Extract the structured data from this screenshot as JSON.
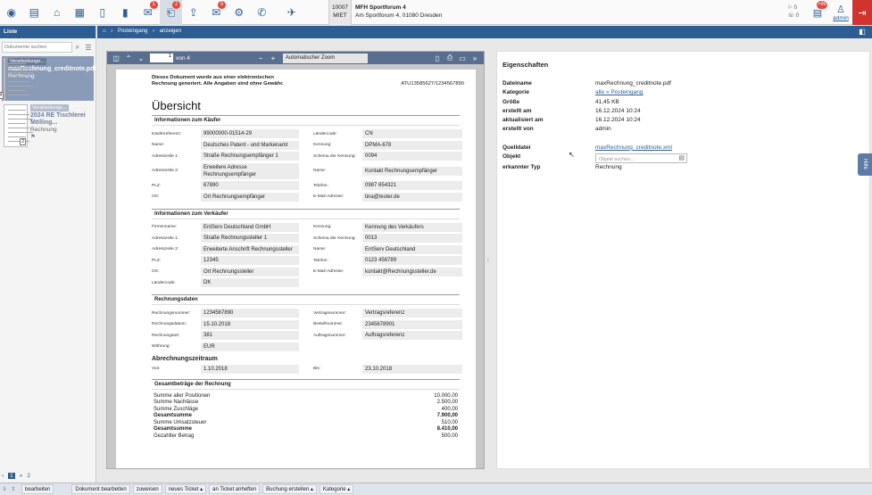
{
  "toolbar": {
    "icons": [
      {
        "name": "globe-icon",
        "glyph": "◉",
        "badge": ""
      },
      {
        "name": "card-icon",
        "glyph": "▤",
        "badge": ""
      },
      {
        "name": "home-icon",
        "glyph": "⌂",
        "badge": ""
      },
      {
        "name": "calendar-icon",
        "glyph": "▦",
        "badge": ""
      },
      {
        "name": "document-icon",
        "glyph": "▯",
        "badge": ""
      },
      {
        "name": "chart-icon",
        "glyph": "▮",
        "badge": ""
      },
      {
        "name": "mail-icon",
        "glyph": "✉",
        "badge": "1"
      },
      {
        "name": "inbox-icon",
        "glyph": "⎗",
        "badge": "2"
      },
      {
        "name": "upload-icon",
        "glyph": "⇪",
        "badge": ""
      },
      {
        "name": "mail-outgoing-icon",
        "glyph": "✉",
        "badge": "5"
      },
      {
        "name": "gear-icon",
        "glyph": "⚙",
        "badge": ""
      },
      {
        "name": "phone-icon",
        "glyph": "✆",
        "badge": ""
      },
      {
        "name": "rocket-icon",
        "glyph": "✈",
        "badge": ""
      }
    ],
    "active_index": 7
  },
  "object": {
    "code": "10007",
    "type": "MIET",
    "name": "MFH Sportforum 4",
    "address": "Am Sportforum 4, 01080 Dresden"
  },
  "topright": {
    "small1": "0",
    "small2": "0",
    "notify_badge": ">99",
    "user": "admin"
  },
  "left": {
    "title": "Liste",
    "search_placeholder": "Dokumente suchen",
    "docs": [
      {
        "status": "Verarbeitunge...",
        "title": "maxRechnung_creditnote.pdf",
        "type": "Rechnung",
        "pages": "4"
      },
      {
        "status": "Verarbeitunge...",
        "title": "2024 RE Tischlerei Mölling...",
        "type": "Rechnung",
        "pages": "2"
      }
    ],
    "pager": [
      "1",
      "2"
    ]
  },
  "breadcrumb": [
    "Posteingang",
    "anzeigen"
  ],
  "viewer": {
    "page_current": "1",
    "page_of": "von 4",
    "zoom": "Automatischer Zoom",
    "header_line1": "Dieses Dokument wurde aus einer elektronischen",
    "header_line2": "Rechnung generiert. Alle Angaben sind ohne Gewähr.",
    "vat_id": "ATU13585627/1234567890",
    "heading": "Übersicht",
    "sections": [
      {
        "title": "Informationen zum Käufer",
        "rows": [
          [
            "Käuferreferenz:",
            "99000000-01514-29",
            "Ländercode:",
            "CN"
          ],
          [
            "Name:",
            "Deutsches Patent - und Markenamt",
            "Kennung:",
            "DPMA-678"
          ],
          [
            "Adresszeile 1:",
            "Straße Rechnungsempfänger 1",
            "Schema der Kennung:",
            "0094"
          ],
          [
            "Adresszeile 2:",
            "Erweitere Adresse Rechnungsempfänger",
            "Name:",
            "Kontakt Rechnungsempfänger"
          ],
          [
            "PLZ:",
            "67890",
            "Telefon:",
            "0987 654321"
          ],
          [
            "Ort:",
            "Ort Rechnungsempfänger",
            "E-Mail-Adresse:",
            "tina@tester.de"
          ]
        ]
      },
      {
        "title": "Informationen zum Verkäufer",
        "rows": [
          [
            "Firmenname:",
            "EntServ Deutschland GmbH",
            "Kennung:",
            "Kennung des Verkäufers"
          ],
          [
            "Adresszeile 1:",
            "Straße Rechnungssteller 1",
            "Schema der Kennung:",
            "0013"
          ],
          [
            "Adresszeile 2:",
            "Erweiterte Anschrift Rechnungssteller",
            "Name:",
            "EntServ Deutschland"
          ],
          [
            "PLZ:",
            "12345",
            "Telefon:",
            "0123 456789"
          ],
          [
            "Ort:",
            "Ort Rechnungssteller",
            "E-Mail-Adresse:",
            "kontakt@Rechnungssteller.de"
          ],
          [
            "Ländercode:",
            "DK",
            "",
            ""
          ]
        ]
      },
      {
        "title": "Rechnungsdaten",
        "rows": [
          [
            "Rechnungsnummer:",
            "1234567890",
            "Vertragsnummer:",
            "Vertragsreferenz"
          ],
          [
            "Rechnungsdatum:",
            "15.10.2018",
            "Bestellnummer:",
            "2345678901"
          ],
          [
            "Rechnungsart:",
            "381",
            "Auftragsnummer:",
            "Auftragsreferenz"
          ],
          [
            "Währung:",
            "EUR",
            "",
            ""
          ]
        ]
      }
    ],
    "period_title": "Abrechnungszeitraum",
    "period_row": [
      "Von:",
      "1.10.2018",
      "Bis:",
      "23.10.2018"
    ],
    "totals_title": "Gesamtbeträge der Rechnung",
    "totals": [
      [
        "Summe aller Positionen",
        "10.000,00",
        false
      ],
      [
        "Summe Nachlässe",
        "2.500,00",
        false
      ],
      [
        "Summe Zuschläge",
        "400,00",
        false
      ],
      [
        "Gesamtsumme",
        "7.900,00",
        true
      ],
      [
        "Summe Umsatzsteuer",
        "510,00",
        false
      ],
      [
        "Gesamtsumme",
        "8.410,00",
        true
      ],
      [
        "Gezahlter Betrag",
        "500,00",
        false
      ]
    ]
  },
  "props": {
    "title": "Eigenschaften",
    "rows": [
      [
        "Dateiname",
        "maxRechnung_creditnote.pdf",
        false
      ],
      [
        "Kategorie",
        "alle » Posteingang",
        true
      ],
      [
        "Größe",
        "41,45 KB",
        false
      ],
      [
        "erstellt am",
        "16.12.2024 10:24",
        false
      ],
      [
        "aktualisiert am",
        "16.12.2024 10:24",
        false
      ],
      [
        "erstellt von",
        "admin",
        false
      ]
    ],
    "source_label": "Quelldatei",
    "source_value": "maxRechnung_creditnote.xml",
    "object_label": "Objekt",
    "object_placeholder": "Objekt suchen...",
    "type_label": "erkannter Typ",
    "type_value": "Rechnung"
  },
  "help_label": "Hilfe",
  "bottom": {
    "items": [
      "bearbeiten",
      "Dokument bearbeiten",
      "zuweisen",
      "neues Ticket",
      "an Ticket anheften",
      "Buchung erstellen",
      "Kategorie"
    ],
    "dropdown": [
      false,
      false,
      false,
      true,
      false,
      true,
      true
    ]
  }
}
